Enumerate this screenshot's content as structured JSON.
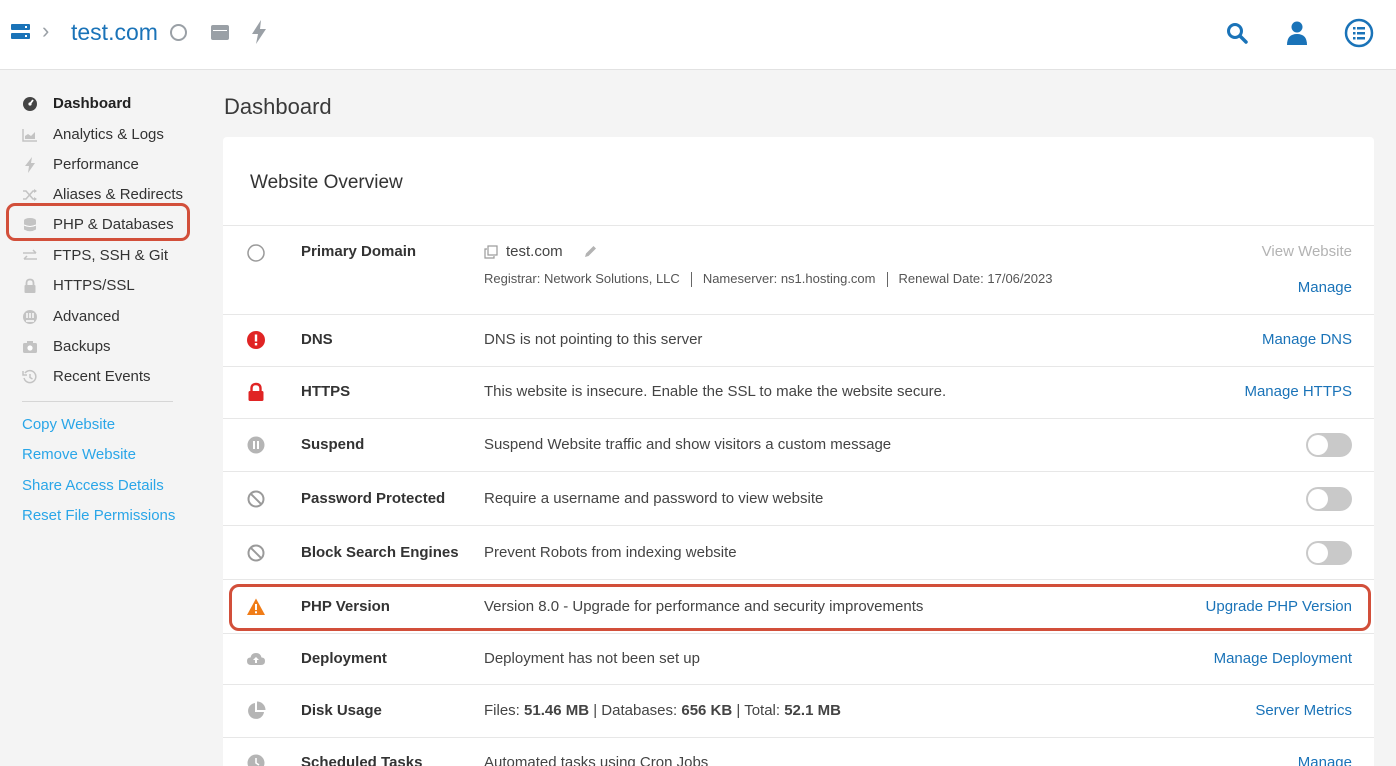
{
  "header": {
    "domain": "test.com",
    "icons": [
      "server-icon",
      "chevron-right-icon",
      "status-circle-icon",
      "window-icon",
      "bolt-icon",
      "search-icon",
      "user-icon",
      "menu-list-icon"
    ]
  },
  "sidebar": {
    "items": [
      {
        "label": "Dashboard",
        "icon": "dashboard-icon",
        "active": true
      },
      {
        "label": "Analytics & Logs",
        "icon": "analytics-icon"
      },
      {
        "label": "Performance",
        "icon": "bolt-icon"
      },
      {
        "label": "Aliases & Redirects",
        "icon": "shuffle-icon"
      },
      {
        "label": "PHP & Databases",
        "icon": "database-icon",
        "highlighted": true
      },
      {
        "label": "FTPS, SSH & Git",
        "icon": "transfer-icon"
      },
      {
        "label": "HTTPS/SSL",
        "icon": "lock-icon"
      },
      {
        "label": "Advanced",
        "icon": "advanced-icon"
      },
      {
        "label": "Backups",
        "icon": "camera-icon"
      },
      {
        "label": "Recent Events",
        "icon": "history-icon"
      }
    ],
    "links": [
      "Copy Website",
      "Remove Website",
      "Share Access Details",
      "Reset File Permissions"
    ]
  },
  "main": {
    "title": "Dashboard",
    "card_title": "Website Overview",
    "primary_domain": {
      "label": "Primary Domain",
      "domain": "test.com",
      "registrar": "Registrar: Network Solutions, LLC",
      "nameserver": "Nameserver: ns1.hosting.com",
      "renewal": "Renewal Date: 17/06/2023",
      "view_action": "View Website",
      "manage_action": "Manage"
    },
    "rows": [
      {
        "label": "DNS",
        "desc": "DNS is not pointing to this server",
        "action": "Manage DNS",
        "icon": "error-icon"
      },
      {
        "label": "HTTPS",
        "desc": "This website is insecure. Enable the SSL to make the website secure.",
        "action": "Manage HTTPS",
        "icon": "lock-icon"
      },
      {
        "label": "Suspend",
        "desc": "Suspend Website traffic and show visitors a custom message",
        "toggle": false,
        "icon": "pause-icon"
      },
      {
        "label": "Password Protected",
        "desc": "Require a username and password to view website",
        "toggle": false,
        "icon": "blocked-icon"
      },
      {
        "label": "Block Search Engines",
        "desc": "Prevent Robots from indexing website",
        "toggle": false,
        "icon": "blocked-icon"
      },
      {
        "label": "PHP Version",
        "desc": "Version 8.0 - Upgrade for performance and security improvements",
        "action": "Upgrade PHP Version",
        "icon": "warning-icon",
        "highlighted": true
      },
      {
        "label": "Deployment",
        "desc": "Deployment has not been set up",
        "action": "Manage Deployment",
        "icon": "cloud-upload-icon"
      },
      {
        "label": "Disk Usage",
        "action": "Server Metrics",
        "icon": "pie-chart-icon",
        "disk": {
          "files_label": "Files:",
          "files": "51.46 MB",
          "db_label": "Databases:",
          "db": "656 KB",
          "total_label": "Total:",
          "total": "52.1 MB"
        }
      },
      {
        "label": "Scheduled Tasks",
        "desc": "Automated tasks using Cron Jobs",
        "action": "Manage",
        "icon": "clock-icon"
      }
    ]
  },
  "colors": {
    "accent": "#1a73b8",
    "link": "#2aa6e8",
    "error": "#e02424",
    "warning": "#f07c17",
    "highlight": "#d24f3a"
  }
}
